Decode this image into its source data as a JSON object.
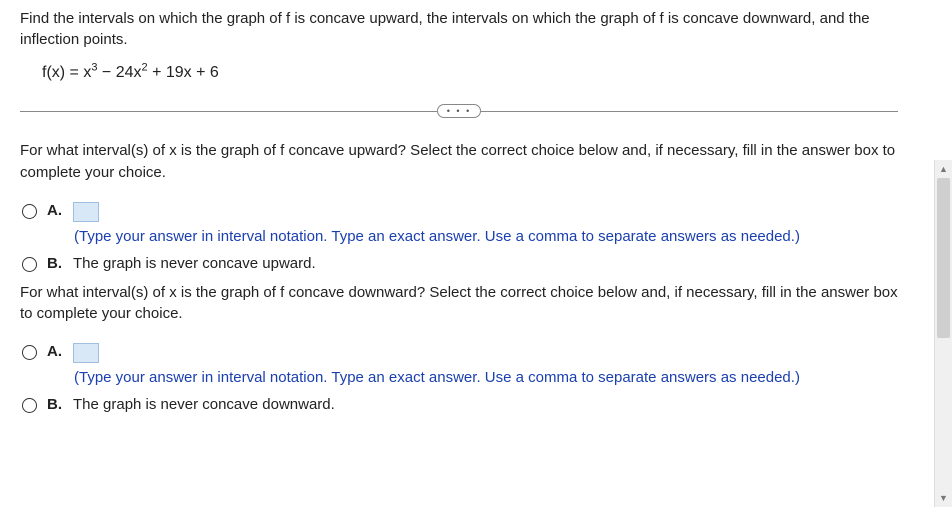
{
  "intro": "Find the intervals on which the graph of f is concave upward, the intervals on which the graph of f is concave downward, and the inflection points.",
  "formula": {
    "prefix": "f(x) = x",
    "e1": "3",
    "mid1": " − 24x",
    "e2": "2",
    "tail": " + 19x + 6"
  },
  "q1": {
    "text": "For what interval(s) of x is the graph of f concave upward? Select the correct choice below and, if necessary, fill in the answer box to complete your choice.",
    "optA_label": "A.",
    "optA_hint": "(Type your answer in interval notation. Type an exact answer. Use a comma to separate answers as needed.)",
    "optB_label": "B.",
    "optB_text": "The graph is never concave upward."
  },
  "q2": {
    "text": "For what interval(s) of x is the graph of f concave downward? Select the correct choice below and, if necessary, fill in the answer box to complete your choice.",
    "optA_label": "A.",
    "optA_hint": "(Type your answer in interval notation. Type an exact answer. Use a comma to separate answers as needed.)",
    "optB_label": "B.",
    "optB_text": "The graph is never concave downward."
  },
  "glyphs": {
    "dots": "• • •",
    "up": "▲",
    "down": "▼"
  }
}
